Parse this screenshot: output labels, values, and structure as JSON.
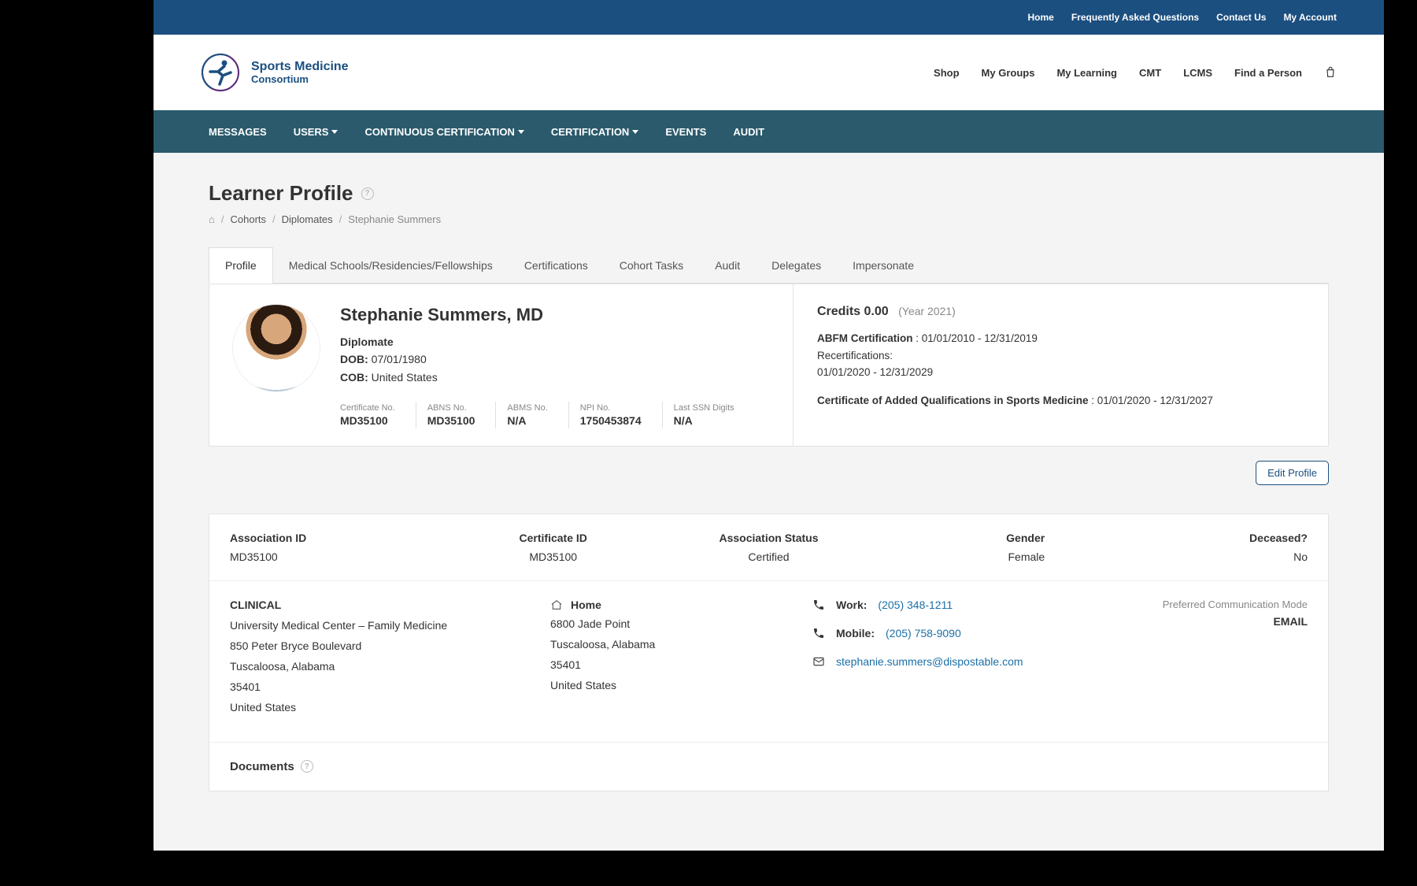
{
  "utilbar": [
    "Home",
    "Frequently Asked Questions",
    "Contact Us",
    "My Account"
  ],
  "logo": {
    "line1": "Sports Medicine",
    "line2": "Consortium"
  },
  "header_nav": [
    "Shop",
    "My Groups",
    "My Learning",
    "CMT",
    "LCMS",
    "Find a Person"
  ],
  "secnav": [
    {
      "label": "MESSAGES",
      "dropdown": false
    },
    {
      "label": "USERS",
      "dropdown": true
    },
    {
      "label": "CONTINUOUS CERTIFICATION",
      "dropdown": true
    },
    {
      "label": "CERTIFICATION",
      "dropdown": true
    },
    {
      "label": "EVENTS",
      "dropdown": false
    },
    {
      "label": "AUDIT",
      "dropdown": false
    }
  ],
  "page_title": "Learner Profile",
  "breadcrumb": [
    "Cohorts",
    "Diplomates",
    "Stephanie Summers"
  ],
  "tabs": [
    "Profile",
    "Medical Schools/Residencies/Fellowships",
    "Certifications",
    "Cohort Tasks",
    "Audit",
    "Delegates",
    "Impersonate"
  ],
  "active_tab_index": 0,
  "person": {
    "name": "Stephanie Summers, MD",
    "role": "Diplomate",
    "dob_label": "DOB:",
    "dob": "07/01/1980",
    "cob_label": "COB:",
    "cob": "United States",
    "ids": [
      {
        "label": "Certificate No.",
        "value": "MD35100"
      },
      {
        "label": "ABNS No.",
        "value": "MD35100"
      },
      {
        "label": "ABMS No.",
        "value": "N/A"
      },
      {
        "label": "NPI No.",
        "value": "1750453874"
      },
      {
        "label": "Last SSN Digits",
        "value": "N/A"
      }
    ]
  },
  "credits": {
    "title": "Credits 0.00",
    "year": "(Year 2021)",
    "abfm_label": "ABFM Certification",
    "abfm_range": ": 01/01/2010 - 12/31/2019",
    "recert_label": "Recertifications:",
    "recert_range": "01/01/2020 - 12/31/2029",
    "caq_label": "Certificate of Added Qualifications in Sports Medicine",
    "caq_range": ": 01/01/2020 - 12/31/2027"
  },
  "edit_button": "Edit Profile",
  "info_top": [
    {
      "label": "Association ID",
      "value": "MD35100"
    },
    {
      "label": "Certificate ID",
      "value": "MD35100"
    },
    {
      "label": "Association Status",
      "value": "Certified"
    },
    {
      "label": "Gender",
      "value": "Female"
    },
    {
      "label": "Deceased?",
      "value": "No"
    }
  ],
  "clinical": {
    "header": "CLINICAL",
    "lines": [
      "University Medical Center – Family Medicine",
      "850 Peter Bryce Boulevard",
      "Tuscaloosa, Alabama",
      "35401",
      "United States"
    ]
  },
  "home": {
    "header": "Home",
    "lines": [
      "6800 Jade Point",
      "Tuscaloosa, Alabama",
      "35401",
      "United States"
    ]
  },
  "contact": {
    "work_label": "Work:",
    "work_phone": "(205) 348-1211",
    "mobile_label": "Mobile:",
    "mobile_phone": "(205) 758-9090",
    "email": "stephanie.summers@dispostable.com"
  },
  "pcm": {
    "label": "Preferred Communication Mode",
    "value": "EMAIL"
  },
  "documents_header": "Documents"
}
